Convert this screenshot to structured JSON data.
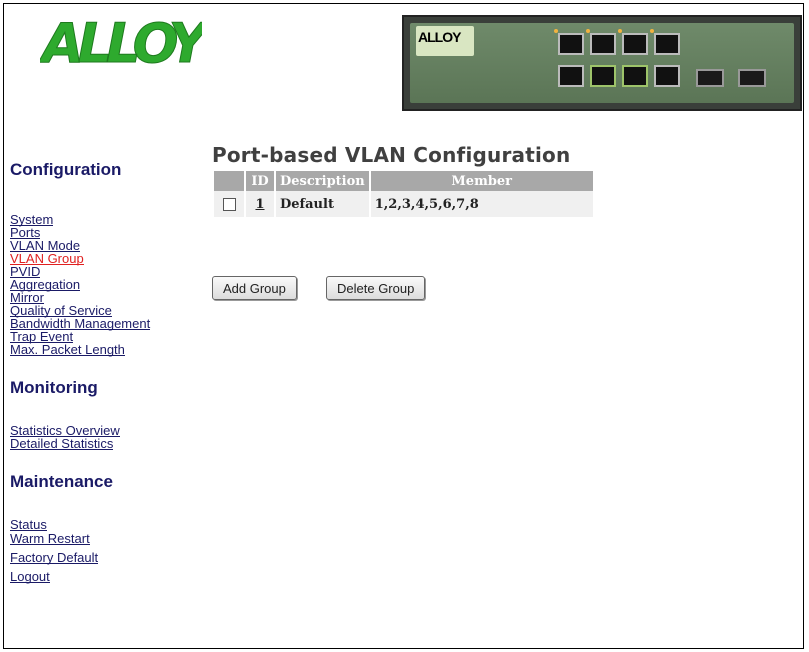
{
  "brand": {
    "logo_text": "ALLOY",
    "switch_brand": "ALLOY"
  },
  "sidebar": {
    "configuration": {
      "title": "Configuration",
      "links": [
        "System",
        "Ports",
        "VLAN Mode",
        "VLAN Group",
        "PVID",
        "Aggregation",
        "Mirror",
        "Quality of Service",
        "Bandwidth Management",
        "Trap Event",
        "Max. Packet Length"
      ],
      "active": "VLAN Group"
    },
    "monitoring": {
      "title": "Monitoring",
      "links": [
        "Statistics Overview",
        "Detailed Statistics"
      ]
    },
    "maintenance": {
      "title": "Maintenance",
      "links": [
        "Status",
        "Warm Restart",
        "Factory Default",
        "Logout"
      ]
    }
  },
  "main": {
    "title": "Port-based VLAN Configuration",
    "table": {
      "headers": [
        "",
        "ID",
        "Description",
        "Member"
      ],
      "rows": [
        {
          "checked": false,
          "id": "1",
          "description": "Default",
          "member": "1,2,3,4,5,6,7,8"
        }
      ]
    },
    "buttons": {
      "add": "Add Group",
      "delete": "Delete Group"
    }
  },
  "colors": {
    "nav_link": "#1a1a66",
    "nav_active": "#e02020",
    "logo_green": "#2eaa2e",
    "table_header": "#a8a8a8"
  }
}
